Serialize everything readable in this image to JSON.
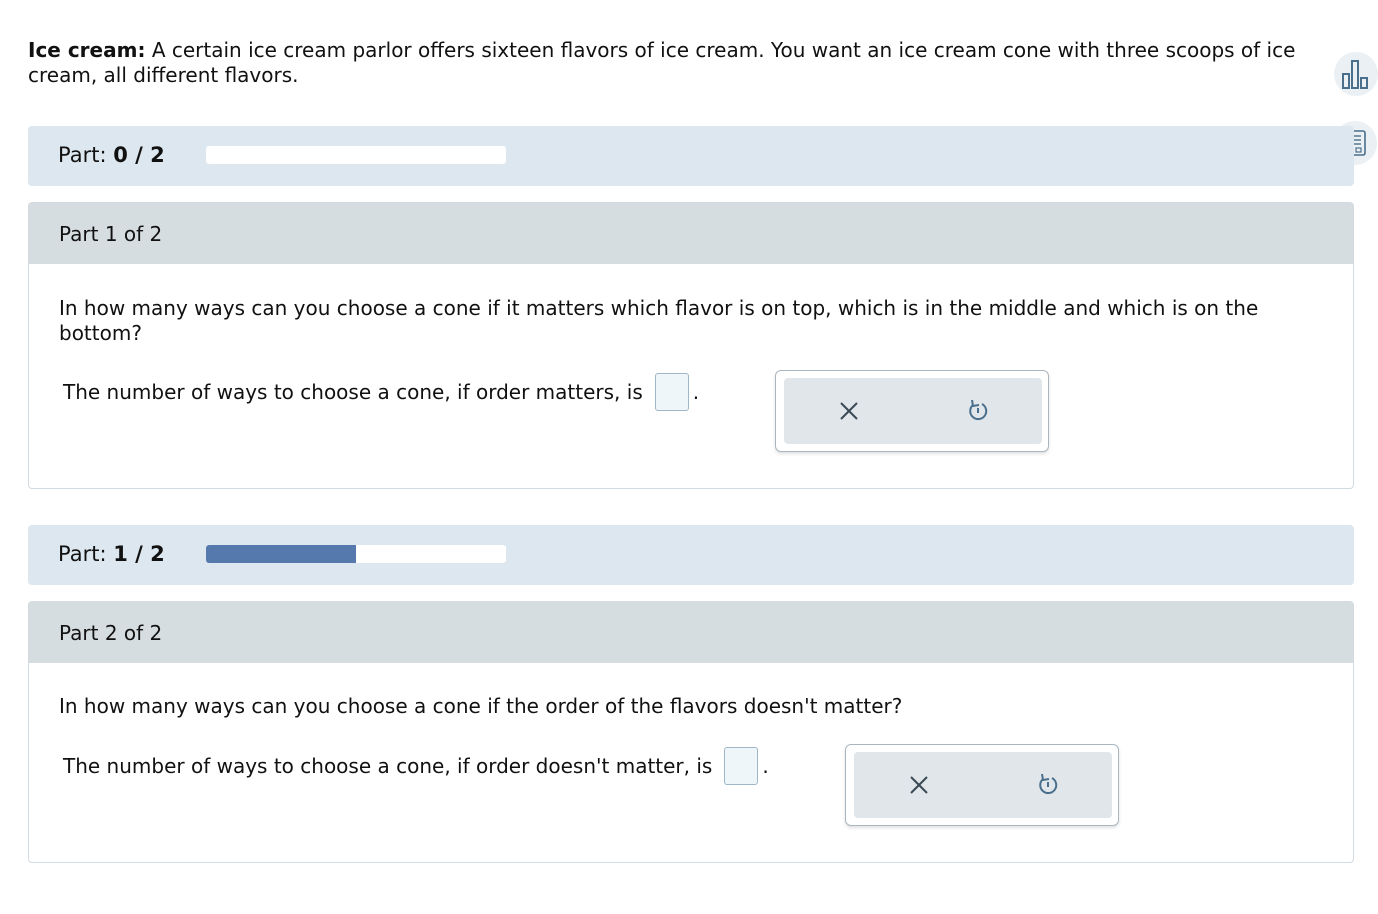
{
  "problem": {
    "title": "Ice cream:",
    "text": "A certain ice cream parlor offers sixteen flavors of ice cream. You want an ice cream cone with three scoops of ice cream, all different flavors."
  },
  "side_tools": {
    "top_icon": "bar-chart-icon",
    "bottom_icon": "notebook-icon"
  },
  "progress": [
    {
      "label": "Part:",
      "value": "0 / 2",
      "fraction": 0.0
    },
    {
      "label": "Part:",
      "value": "1 / 2",
      "fraction": 0.5
    }
  ],
  "parts": [
    {
      "header": "Part 1 of 2",
      "question": "In how many ways can you choose a cone if it matters which flavor is on top, which is in the middle and which is on the bottom?",
      "answer_prefix": "The number of ways to choose a cone, if order matters, is",
      "answer_value": "",
      "answer_suffix": "."
    },
    {
      "header": "Part 2 of 2",
      "question": "In how many ways can you choose a cone if the order of the flavors doesn't matter?",
      "answer_prefix": "The number of ways to choose a cone, if order doesn't matter, is",
      "answer_value": "",
      "answer_suffix": "."
    }
  ],
  "colors": {
    "progress_bg": "#dde7ef",
    "progress_fill": "#5579ad",
    "part_header_bg": "#d5dde1",
    "answer_box_bg": "#eef6fa"
  }
}
